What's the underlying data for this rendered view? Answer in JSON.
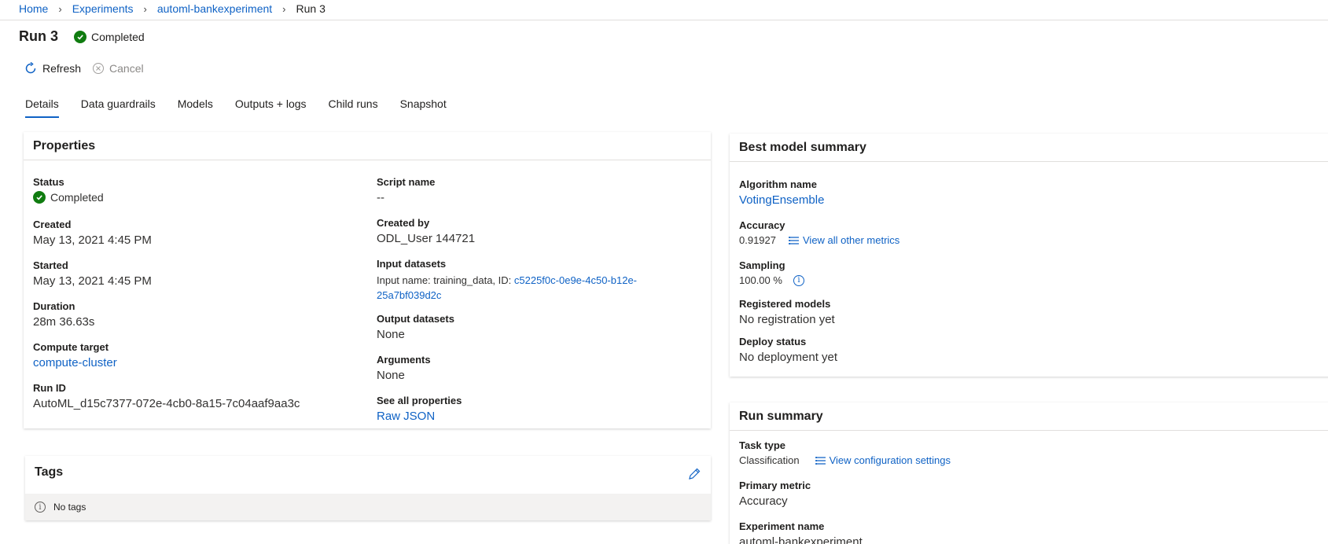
{
  "breadcrumb": {
    "home": "Home",
    "experiments": "Experiments",
    "experiment": "automl-bankexperiment",
    "current": "Run 3"
  },
  "run": {
    "title": "Run 3",
    "status": "Completed"
  },
  "toolbar": {
    "refresh": "Refresh",
    "cancel": "Cancel"
  },
  "tabs": [
    "Details",
    "Data guardrails",
    "Models",
    "Outputs + logs",
    "Child runs",
    "Snapshot"
  ],
  "properties": {
    "title": "Properties",
    "status_label": "Status",
    "status_value": "Completed",
    "created_label": "Created",
    "created_value": "May 13, 2021 4:45 PM",
    "started_label": "Started",
    "started_value": "May 13, 2021 4:45 PM",
    "duration_label": "Duration",
    "duration_value": "28m 36.63s",
    "compute_label": "Compute target",
    "compute_value": "compute-cluster",
    "runid_label": "Run ID",
    "runid_value": "AutoML_d15c7377-072e-4cb0-8a15-7c04aaf9aa3c",
    "script_label": "Script name",
    "script_value": "--",
    "createdby_label": "Created by",
    "createdby_value": "ODL_User 144721",
    "inputds_label": "Input datasets",
    "inputds_prefix": "Input name: training_data, ID: ",
    "inputds_id_part1": "c5225f0c-0e9e-4c50-b12e-",
    "inputds_id_part2": "25a7bf039d2c",
    "outputds_label": "Output datasets",
    "outputds_value": "None",
    "args_label": "Arguments",
    "args_value": "None",
    "allprops_label": "See all properties",
    "allprops_value": "Raw JSON"
  },
  "best_model": {
    "title": "Best model summary",
    "algo_label": "Algorithm name",
    "algo_value": "VotingEnsemble",
    "acc_label": "Accuracy",
    "acc_value": "0.91927",
    "acc_link": "View all other metrics",
    "sampling_label": "Sampling",
    "sampling_value": "100.00 %",
    "registered_label": "Registered models",
    "registered_value": "No registration yet",
    "deploy_label": "Deploy status",
    "deploy_value": "No deployment yet"
  },
  "run_summary": {
    "title": "Run summary",
    "task_label": "Task type",
    "task_value": "Classification",
    "task_link": "View configuration settings",
    "metric_label": "Primary metric",
    "metric_value": "Accuracy",
    "exp_label": "Experiment name",
    "exp_value": "automl-bankexperiment"
  },
  "tags": {
    "title": "Tags",
    "empty": "No tags"
  },
  "colors": {
    "accent": "#0f62c5",
    "success": "#107c10"
  }
}
